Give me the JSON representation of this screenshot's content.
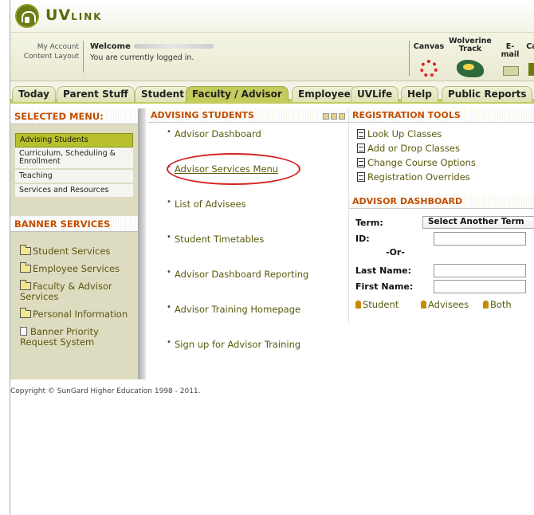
{
  "brand": {
    "logo_main": "UV",
    "logo_small": "LINK"
  },
  "account": {
    "my_account": "My Account",
    "content_layout": "Content Layout"
  },
  "user": {
    "welcome": "Welcome",
    "status": "You are currently logged in."
  },
  "quicklinks": [
    {
      "label": "Canvas",
      "icon": "canvas-icon"
    },
    {
      "label": "Wolverine Track",
      "icon": "wolverine-icon"
    },
    {
      "label": "E-mail",
      "icon": "email-icon"
    },
    {
      "label": "Ca",
      "icon": "calendar-icon"
    }
  ],
  "tabs": [
    {
      "label": "Today"
    },
    {
      "label": "Parent Stuff"
    },
    {
      "label": "Student"
    },
    {
      "label": "Faculty / Advisor",
      "active": true
    },
    {
      "label": "Employee"
    },
    {
      "label": "UVLife"
    },
    {
      "label": "Help"
    },
    {
      "label": "Public Reports"
    }
  ],
  "selected_menu": {
    "title": "SELECTED MENU:",
    "items": [
      "Advising Students",
      "Curriculum, Scheduling & Enrollment",
      "Teaching",
      "Services and Resources"
    ]
  },
  "banner_services": {
    "title": "BANNER SERVICES",
    "items": [
      "Student Services",
      "Employee Services",
      "Faculty & Advisor Services",
      "Personal Information",
      "Banner Priority Request System"
    ]
  },
  "advising": {
    "title": "ADVISING STUDENTS",
    "links": [
      "Advisor Dashboard",
      "Advisor Services Menu",
      "List of Advisees",
      "Student Timetables",
      "Advisor Dashboard Reporting",
      "Advisor Training Homepage",
      "Sign up for Advisor Training"
    ]
  },
  "registration": {
    "title": "REGISTRATION TOOLS",
    "links": [
      "Look Up Classes",
      "Add or Drop Classes",
      "Change Course Options",
      "Registration Overrides"
    ]
  },
  "advisor_dashboard": {
    "title": "ADVISOR DASHBOARD",
    "term_label": "Term:",
    "term_value": "Select Another Term",
    "id_label": "ID:",
    "or_label": "-Or-",
    "last_name_label": "Last Name:",
    "first_name_label": "First Name:",
    "buttons": [
      "Student",
      "Advisees",
      "Both"
    ]
  },
  "footer": {
    "copyright": "Copyright © SunGard Higher Education 1998 - 2011."
  },
  "colors": {
    "accent": "#c3cc5c",
    "heading": "#c34f00",
    "link": "#5a5a0e",
    "highlight": "#d62020"
  }
}
